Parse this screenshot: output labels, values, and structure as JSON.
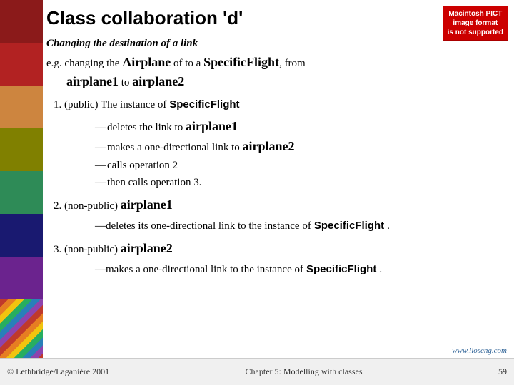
{
  "slide": {
    "title": "Class collaboration 'd'",
    "subtitle": "Changing the destination of a link",
    "eg_line": "e.g. changing the Airplane of to a SpecificFlight, from airplane1 to airplane2",
    "watermark": "Macintosh PICT\nimage format\nis not supported",
    "list": [
      {
        "number": "1.",
        "label": "(public) The instance of SpecificFlight",
        "sub": [
          "—deletes the link to airplane1",
          "—makes a one-directional link to airplane2",
          "—calls operation 2",
          "—then calls operation 3."
        ]
      },
      {
        "number": "2.",
        "label": "(non-public) airplane1",
        "sub": [
          "—deletes its one-directional link to the instance of SpecificFlight."
        ]
      },
      {
        "number": "3.",
        "label": "(non-public) airplane2",
        "sub": [
          "—makes a one-directional link to the instance of SpecificFlight."
        ]
      }
    ],
    "www": "www.lloseng.com",
    "footer": {
      "left": "© Lethbridge/Laganière 2001",
      "center": "Chapter 5: Modelling with classes",
      "right": "59"
    }
  },
  "colors": {
    "bar": [
      "#c0392b",
      "#e67e22",
      "#f1c40f",
      "#27ae60",
      "#2980b9",
      "#8e44ad",
      "#c0392b",
      "#e67e22"
    ]
  }
}
